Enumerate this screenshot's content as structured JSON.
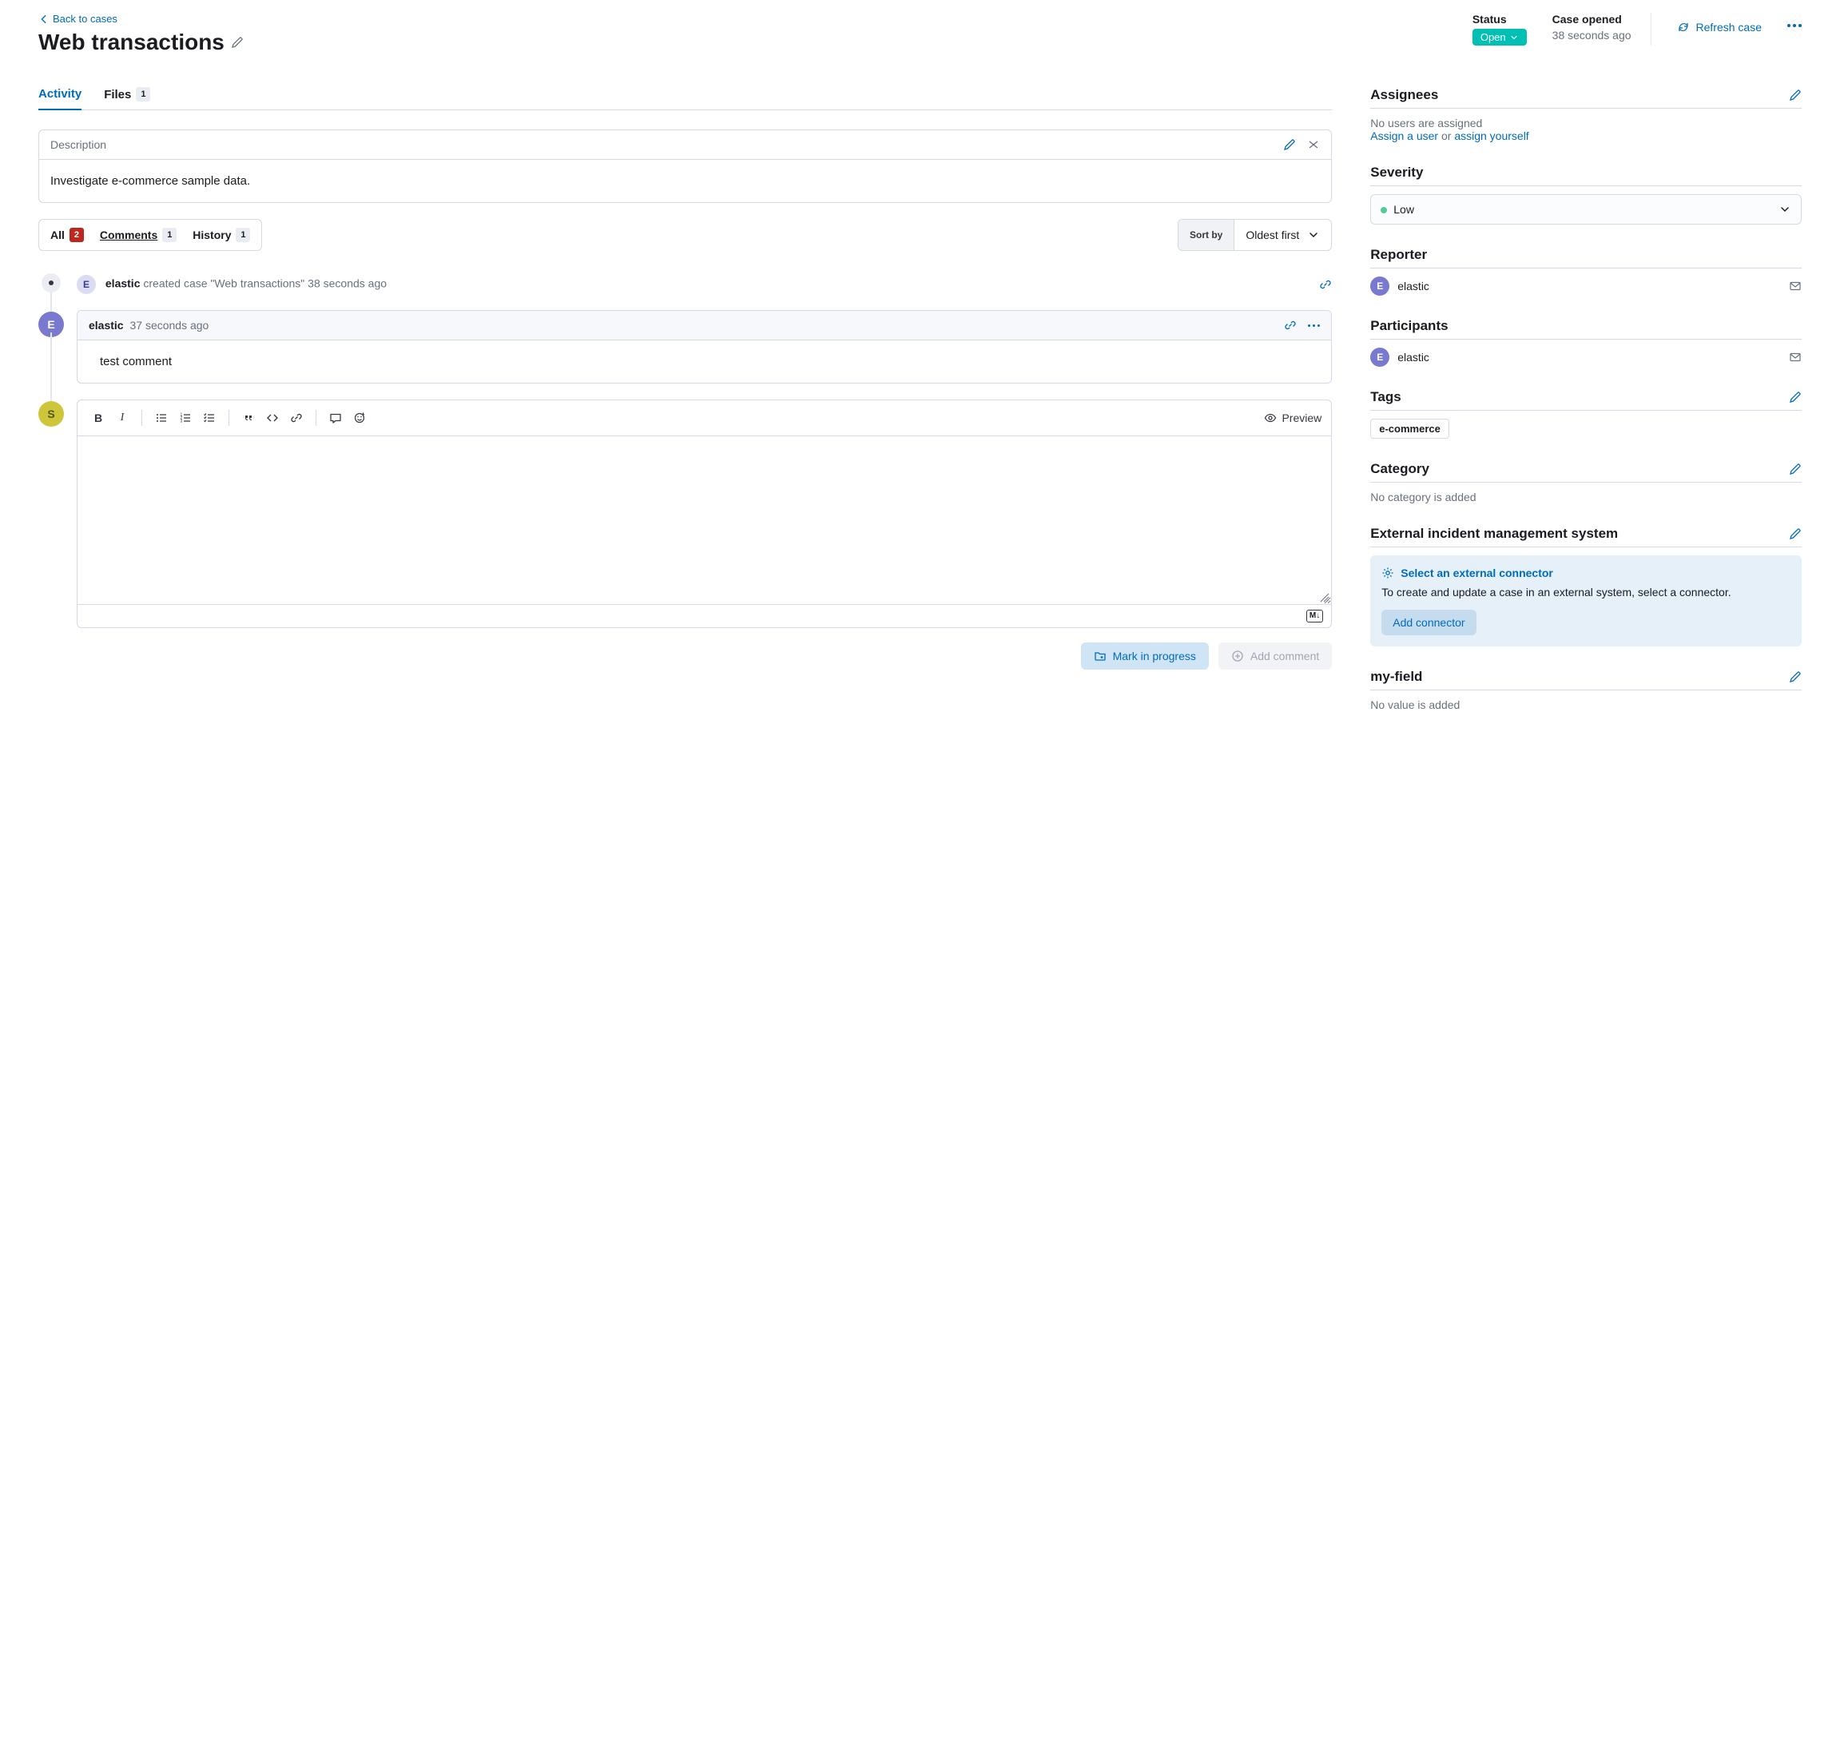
{
  "nav": {
    "back": "Back to cases"
  },
  "title": "Web transactions",
  "header": {
    "status_label": "Status",
    "status_value": "Open",
    "opened_label": "Case opened",
    "opened_value": "38 seconds ago",
    "refresh": "Refresh case"
  },
  "tabs": {
    "activity": "Activity",
    "files": "Files",
    "files_count": "1"
  },
  "description": {
    "label": "Description",
    "body": "Investigate e-commerce sample data."
  },
  "filters": {
    "all": "All",
    "all_count": "2",
    "comments": "Comments",
    "comments_count": "1",
    "history": "History",
    "history_count": "1",
    "sort_label": "Sort by",
    "sort_value": "Oldest first"
  },
  "timeline": {
    "created": {
      "avatar": "E",
      "user": "elastic",
      "action": "created case \"Web transactions\"",
      "time": "38 seconds ago"
    },
    "comment": {
      "avatar": "E",
      "user": "elastic",
      "time": "37 seconds ago",
      "body": "test comment"
    },
    "editor_avatar": "S"
  },
  "editor": {
    "preview": "Preview",
    "markdown": "M↓"
  },
  "actions": {
    "mark_progress": "Mark in progress",
    "add_comment": "Add comment"
  },
  "sidebar": {
    "assignees": {
      "title": "Assignees",
      "empty": "No users are assigned",
      "assign_user": "Assign a user",
      "or": " or ",
      "assign_yourself": "assign yourself"
    },
    "severity": {
      "title": "Severity",
      "value": "Low"
    },
    "reporter": {
      "title": "Reporter",
      "avatar": "E",
      "name": "elastic"
    },
    "participants": {
      "title": "Participants",
      "avatar": "E",
      "name": "elastic"
    },
    "tags": {
      "title": "Tags",
      "value": "e-commerce"
    },
    "category": {
      "title": "Category",
      "empty": "No category is added"
    },
    "incident": {
      "title": "External incident management system",
      "select": "Select an external connector",
      "text": "To create and update a case in an external system, select a connector.",
      "button": "Add connector"
    },
    "custom": {
      "title": "my-field",
      "empty": "No value is added"
    }
  }
}
